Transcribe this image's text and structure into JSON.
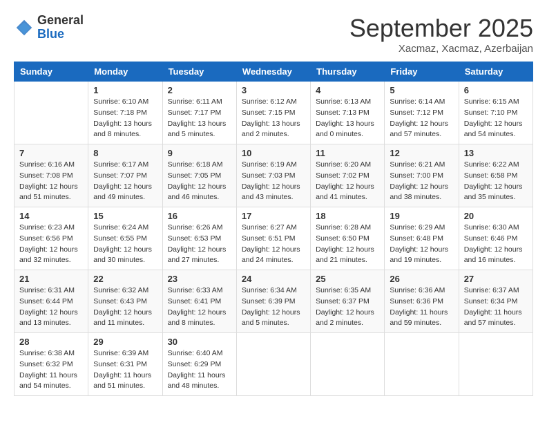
{
  "logo": {
    "general": "General",
    "blue": "Blue"
  },
  "title": "September 2025",
  "location": "Xacmaz, Xacmaz, Azerbaijan",
  "days_of_week": [
    "Sunday",
    "Monday",
    "Tuesday",
    "Wednesday",
    "Thursday",
    "Friday",
    "Saturday"
  ],
  "weeks": [
    [
      {
        "day": "",
        "sunrise": "",
        "sunset": "",
        "daylight": ""
      },
      {
        "day": "1",
        "sunrise": "Sunrise: 6:10 AM",
        "sunset": "Sunset: 7:18 PM",
        "daylight": "Daylight: 13 hours and 8 minutes."
      },
      {
        "day": "2",
        "sunrise": "Sunrise: 6:11 AM",
        "sunset": "Sunset: 7:17 PM",
        "daylight": "Daylight: 13 hours and 5 minutes."
      },
      {
        "day": "3",
        "sunrise": "Sunrise: 6:12 AM",
        "sunset": "Sunset: 7:15 PM",
        "daylight": "Daylight: 13 hours and 2 minutes."
      },
      {
        "day": "4",
        "sunrise": "Sunrise: 6:13 AM",
        "sunset": "Sunset: 7:13 PM",
        "daylight": "Daylight: 13 hours and 0 minutes."
      },
      {
        "day": "5",
        "sunrise": "Sunrise: 6:14 AM",
        "sunset": "Sunset: 7:12 PM",
        "daylight": "Daylight: 12 hours and 57 minutes."
      },
      {
        "day": "6",
        "sunrise": "Sunrise: 6:15 AM",
        "sunset": "Sunset: 7:10 PM",
        "daylight": "Daylight: 12 hours and 54 minutes."
      }
    ],
    [
      {
        "day": "7",
        "sunrise": "Sunrise: 6:16 AM",
        "sunset": "Sunset: 7:08 PM",
        "daylight": "Daylight: 12 hours and 51 minutes."
      },
      {
        "day": "8",
        "sunrise": "Sunrise: 6:17 AM",
        "sunset": "Sunset: 7:07 PM",
        "daylight": "Daylight: 12 hours and 49 minutes."
      },
      {
        "day": "9",
        "sunrise": "Sunrise: 6:18 AM",
        "sunset": "Sunset: 7:05 PM",
        "daylight": "Daylight: 12 hours and 46 minutes."
      },
      {
        "day": "10",
        "sunrise": "Sunrise: 6:19 AM",
        "sunset": "Sunset: 7:03 PM",
        "daylight": "Daylight: 12 hours and 43 minutes."
      },
      {
        "day": "11",
        "sunrise": "Sunrise: 6:20 AM",
        "sunset": "Sunset: 7:02 PM",
        "daylight": "Daylight: 12 hours and 41 minutes."
      },
      {
        "day": "12",
        "sunrise": "Sunrise: 6:21 AM",
        "sunset": "Sunset: 7:00 PM",
        "daylight": "Daylight: 12 hours and 38 minutes."
      },
      {
        "day": "13",
        "sunrise": "Sunrise: 6:22 AM",
        "sunset": "Sunset: 6:58 PM",
        "daylight": "Daylight: 12 hours and 35 minutes."
      }
    ],
    [
      {
        "day": "14",
        "sunrise": "Sunrise: 6:23 AM",
        "sunset": "Sunset: 6:56 PM",
        "daylight": "Daylight: 12 hours and 32 minutes."
      },
      {
        "day": "15",
        "sunrise": "Sunrise: 6:24 AM",
        "sunset": "Sunset: 6:55 PM",
        "daylight": "Daylight: 12 hours and 30 minutes."
      },
      {
        "day": "16",
        "sunrise": "Sunrise: 6:26 AM",
        "sunset": "Sunset: 6:53 PM",
        "daylight": "Daylight: 12 hours and 27 minutes."
      },
      {
        "day": "17",
        "sunrise": "Sunrise: 6:27 AM",
        "sunset": "Sunset: 6:51 PM",
        "daylight": "Daylight: 12 hours and 24 minutes."
      },
      {
        "day": "18",
        "sunrise": "Sunrise: 6:28 AM",
        "sunset": "Sunset: 6:50 PM",
        "daylight": "Daylight: 12 hours and 21 minutes."
      },
      {
        "day": "19",
        "sunrise": "Sunrise: 6:29 AM",
        "sunset": "Sunset: 6:48 PM",
        "daylight": "Daylight: 12 hours and 19 minutes."
      },
      {
        "day": "20",
        "sunrise": "Sunrise: 6:30 AM",
        "sunset": "Sunset: 6:46 PM",
        "daylight": "Daylight: 12 hours and 16 minutes."
      }
    ],
    [
      {
        "day": "21",
        "sunrise": "Sunrise: 6:31 AM",
        "sunset": "Sunset: 6:44 PM",
        "daylight": "Daylight: 12 hours and 13 minutes."
      },
      {
        "day": "22",
        "sunrise": "Sunrise: 6:32 AM",
        "sunset": "Sunset: 6:43 PM",
        "daylight": "Daylight: 12 hours and 11 minutes."
      },
      {
        "day": "23",
        "sunrise": "Sunrise: 6:33 AM",
        "sunset": "Sunset: 6:41 PM",
        "daylight": "Daylight: 12 hours and 8 minutes."
      },
      {
        "day": "24",
        "sunrise": "Sunrise: 6:34 AM",
        "sunset": "Sunset: 6:39 PM",
        "daylight": "Daylight: 12 hours and 5 minutes."
      },
      {
        "day": "25",
        "sunrise": "Sunrise: 6:35 AM",
        "sunset": "Sunset: 6:37 PM",
        "daylight": "Daylight: 12 hours and 2 minutes."
      },
      {
        "day": "26",
        "sunrise": "Sunrise: 6:36 AM",
        "sunset": "Sunset: 6:36 PM",
        "daylight": "Daylight: 11 hours and 59 minutes."
      },
      {
        "day": "27",
        "sunrise": "Sunrise: 6:37 AM",
        "sunset": "Sunset: 6:34 PM",
        "daylight": "Daylight: 11 hours and 57 minutes."
      }
    ],
    [
      {
        "day": "28",
        "sunrise": "Sunrise: 6:38 AM",
        "sunset": "Sunset: 6:32 PM",
        "daylight": "Daylight: 11 hours and 54 minutes."
      },
      {
        "day": "29",
        "sunrise": "Sunrise: 6:39 AM",
        "sunset": "Sunset: 6:31 PM",
        "daylight": "Daylight: 11 hours and 51 minutes."
      },
      {
        "day": "30",
        "sunrise": "Sunrise: 6:40 AM",
        "sunset": "Sunset: 6:29 PM",
        "daylight": "Daylight: 11 hours and 48 minutes."
      },
      {
        "day": "",
        "sunrise": "",
        "sunset": "",
        "daylight": ""
      },
      {
        "day": "",
        "sunrise": "",
        "sunset": "",
        "daylight": ""
      },
      {
        "day": "",
        "sunrise": "",
        "sunset": "",
        "daylight": ""
      },
      {
        "day": "",
        "sunrise": "",
        "sunset": "",
        "daylight": ""
      }
    ]
  ]
}
